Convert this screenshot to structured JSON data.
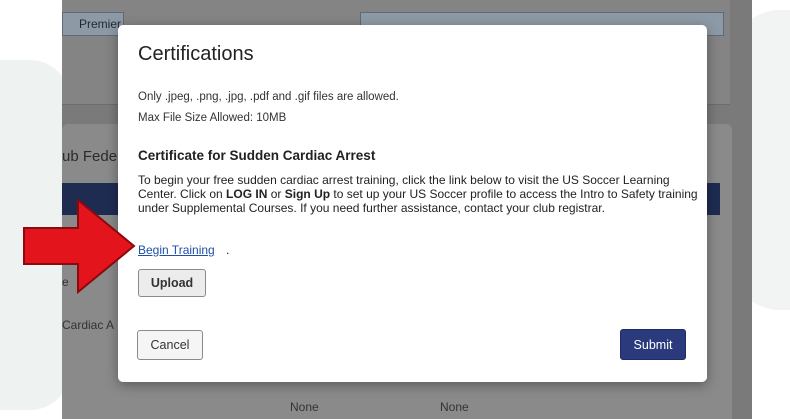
{
  "background": {
    "tab_label": "Premier",
    "club_label": "ub Fede",
    "row_label_e": "e",
    "row_label_cardiac": "Cardiac A",
    "none_1": "None",
    "none_2": "None"
  },
  "modal": {
    "title": "Certifications",
    "allowed_files": "Only .jpeg, .png, .jpg, .pdf and .gif files are allowed.",
    "max_size": "Max File Size Allowed: 10MB",
    "subtitle": "Certificate for Sudden Cardiac Arrest",
    "desc_part1": "To begin your free sudden cardiac arrest training, click the link below to visit the US Soccer Learning Center. Click on ",
    "desc_login": "LOG IN",
    "desc_or": " or ",
    "desc_signup": "Sign Up",
    "desc_part2": " to set up your US Soccer profile to access the Intro to Safety training under Supplemental Courses. If you need further assistance, contact your club registrar.",
    "link_text": "Begin Training",
    "link_suffix": ".",
    "upload_label": "Upload",
    "cancel_label": "Cancel",
    "submit_label": "Submit"
  },
  "colors": {
    "accent_navy": "#2a3a7c",
    "link_blue": "#1f4fa8",
    "arrow_red": "#e3141c"
  },
  "icons": {
    "annotation": "red-arrow-icon"
  }
}
